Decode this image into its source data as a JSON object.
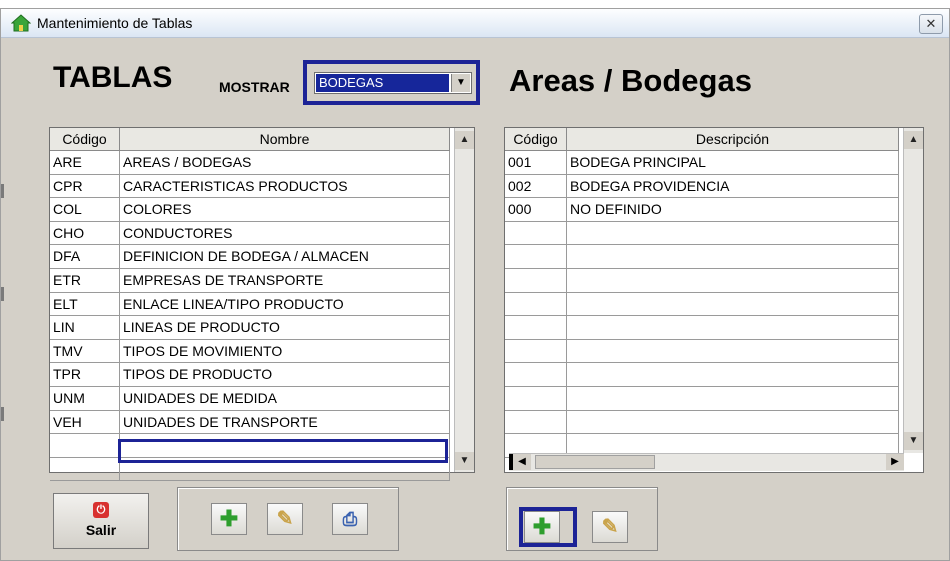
{
  "window": {
    "title": "Mantenimiento de Tablas",
    "close_glyph": "✕",
    "icon": "house-icon"
  },
  "left": {
    "heading": "TABLAS",
    "mostrar_label": "MOSTRAR",
    "mostrar_value": "BODEGAS",
    "columns": [
      "Código",
      "Nombre"
    ],
    "rows": [
      [
        "ARE",
        "AREAS / BODEGAS"
      ],
      [
        "CPR",
        "CARACTERISTICAS PRODUCTOS"
      ],
      [
        "COL",
        "COLORES"
      ],
      [
        "CHO",
        "CONDUCTORES"
      ],
      [
        "DFA",
        "DEFINICION DE BODEGA / ALMACEN"
      ],
      [
        "ETR",
        "EMPRESAS DE TRANSPORTE"
      ],
      [
        "ELT",
        "ENLACE LINEA/TIPO PRODUCTO"
      ],
      [
        "LIN",
        "LINEAS DE PRODUCTO"
      ],
      [
        "TMV",
        "TIPOS DE MOVIMIENTO"
      ],
      [
        "TPR",
        "TIPOS DE PRODUCTO"
      ],
      [
        "UNM",
        "UNIDADES DE MEDIDA"
      ],
      [
        "VEH",
        "UNIDADES DE TRANSPORTE"
      ],
      [
        "",
        ""
      ],
      [
        "",
        ""
      ]
    ],
    "selected_row": 7
  },
  "right": {
    "heading": "Areas / Bodegas",
    "columns": [
      "Código",
      "Descripción"
    ],
    "rows": [
      [
        "001",
        "BODEGA PRINCIPAL"
      ],
      [
        "002",
        "BODEGA PROVIDENCIA"
      ],
      [
        "000",
        "NO DEFINIDO"
      ],
      [
        "",
        ""
      ],
      [
        "",
        ""
      ],
      [
        "",
        ""
      ],
      [
        "",
        ""
      ],
      [
        "",
        ""
      ],
      [
        "",
        ""
      ],
      [
        "",
        ""
      ],
      [
        "",
        ""
      ],
      [
        "",
        ""
      ],
      [
        "",
        ""
      ]
    ]
  },
  "buttons": {
    "salir_label": "Salir",
    "salir_icon": "power-icon",
    "add_icon": "plus-icon",
    "edit_icon": "pencil-icon",
    "print_icon": "printer-icon"
  },
  "colors": {
    "focus": "#1c2396",
    "selection": "#16269a"
  }
}
